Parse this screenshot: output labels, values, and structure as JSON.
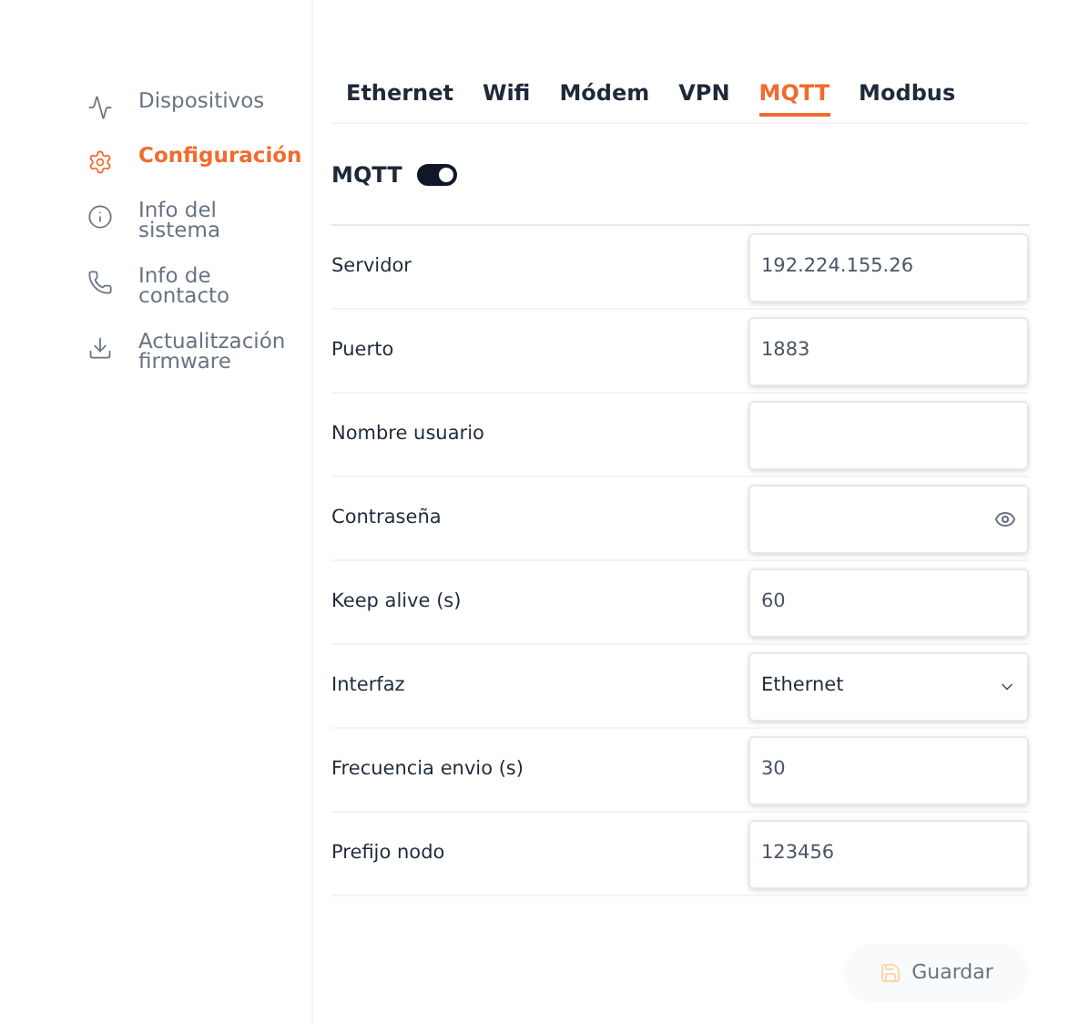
{
  "sidebar": {
    "items": [
      {
        "label": "Dispositivos",
        "selected": false
      },
      {
        "label": "Configuración",
        "selected": true
      },
      {
        "label": "Info del sistema",
        "selected": false
      },
      {
        "label": "Info de contacto",
        "selected": false
      },
      {
        "label": "Actualitzación firmware",
        "selected": false
      }
    ]
  },
  "tabs": [
    {
      "label": "Ethernet",
      "selected": false
    },
    {
      "label": "Wifi",
      "selected": false
    },
    {
      "label": "Módem",
      "selected": false
    },
    {
      "label": "VPN",
      "selected": false
    },
    {
      "label": "MQTT",
      "selected": true
    },
    {
      "label": "Modbus",
      "selected": false
    }
  ],
  "section": {
    "title": "MQTT",
    "enabled": true
  },
  "fields": [
    {
      "label": "Servidor",
      "kind": "text",
      "value": "192.224.155.26"
    },
    {
      "label": "Puerto",
      "kind": "text",
      "value": "1883"
    },
    {
      "label": "Nombre usuario",
      "kind": "text"
    },
    {
      "label": "Contraseña",
      "kind": "password"
    },
    {
      "label": "Keep alive (s)",
      "kind": "text",
      "value": "60"
    },
    {
      "label": "Interfaz",
      "kind": "select",
      "value": "Ethernet"
    },
    {
      "label": "Frecuencia envio (s)",
      "kind": "text",
      "value": "30"
    },
    {
      "label": "Prefijo nodo",
      "kind": "text",
      "value": "123456"
    }
  ],
  "save_button": {
    "label": "Guardar",
    "disabled": true
  }
}
